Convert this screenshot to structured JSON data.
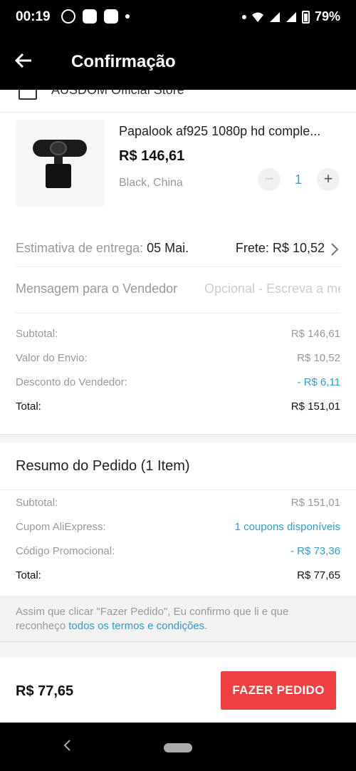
{
  "status_bar": {
    "time": "00:19",
    "battery": "79%"
  },
  "app_bar": {
    "title": "Confirmação"
  },
  "store": {
    "name": "AUSDOM Official Store"
  },
  "product": {
    "title": "Papalook af925 1080p hd comple...",
    "price": "R$ 146,61",
    "variant": "Black, China",
    "quantity": "1",
    "minus": "−",
    "plus": "+"
  },
  "delivery": {
    "label": "Estimativa de entrega:",
    "date": "05 Mai.",
    "shipping": "Frete: R$ 10,52"
  },
  "message": {
    "label": "Mensagem para o Vendedor",
    "placeholder": "Opcional - Escreva a mensagem"
  },
  "store_summary": [
    {
      "label": "Subtotal:",
      "value": "R$ 146,61"
    },
    {
      "label": "Valor do Envio:",
      "value": "R$ 10,52"
    },
    {
      "label": "Desconto do Vendedor:",
      "value": "- R$ 6,11"
    },
    {
      "label": "Total:",
      "value": "R$ 151,01"
    }
  ],
  "order_summary": {
    "title": "Resumo do Pedido (1 Item)",
    "lines": [
      {
        "label": "Subtotal:",
        "value": "R$ 151,01"
      },
      {
        "label": "Cupom AliExpress:",
        "value": "1 coupons disponíveis"
      },
      {
        "label": "Código Promocional:",
        "value": "- R$ 73,36"
      },
      {
        "label": "Total:",
        "value": "R$ 77,65"
      }
    ]
  },
  "terms": {
    "text": "Assim que clicar \"Fazer Pedido\", Eu confirmo que li e que reconheço ",
    "link": "todos os termos e condições",
    "end": "."
  },
  "footer": {
    "total": "R$ 77,65",
    "button": "FAZER PEDIDO"
  },
  "colors": {
    "accent": "#2d9ec9",
    "button": "#ee4040"
  }
}
